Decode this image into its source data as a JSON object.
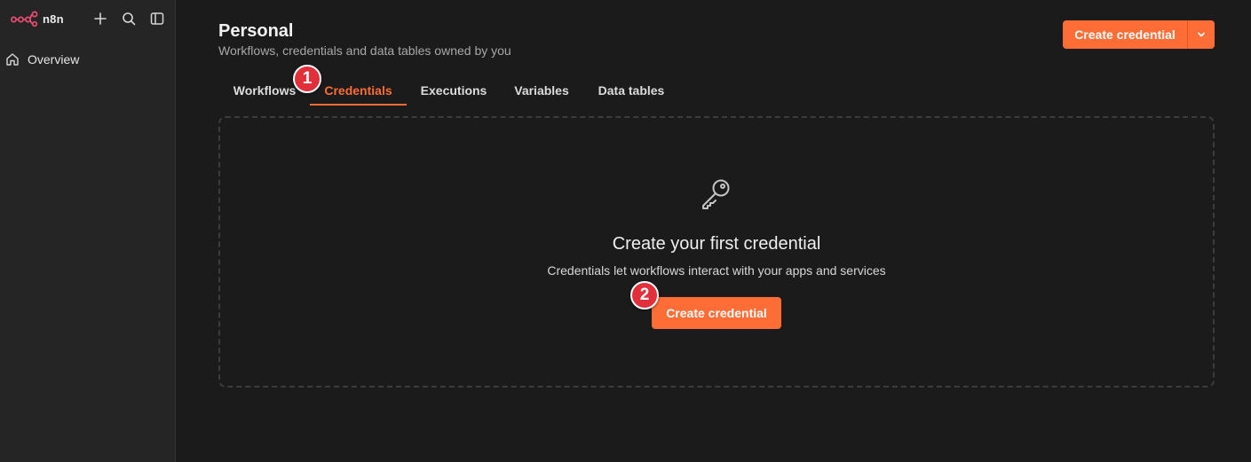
{
  "app": {
    "brand": "n8n",
    "accent_color": "#ff6d36"
  },
  "sidebar": {
    "icons": [
      "add-icon",
      "search-icon",
      "toggle-sidebar-icon"
    ],
    "items": [
      {
        "label": "Overview",
        "icon": "home-icon"
      }
    ]
  },
  "header": {
    "title": "Personal",
    "subtitle": "Workflows, credentials and data tables owned by you",
    "create_button": "Create credential",
    "dropdown_icon": "chevron-down-icon"
  },
  "tabs": [
    {
      "label": "Workflows",
      "active": false
    },
    {
      "label": "Credentials",
      "active": true
    },
    {
      "label": "Executions",
      "active": false
    },
    {
      "label": "Variables",
      "active": false
    },
    {
      "label": "Data tables",
      "active": false
    }
  ],
  "empty_state": {
    "icon": "key-icon",
    "title": "Create your first credential",
    "description": "Credentials let workflows interact with your apps and services",
    "button": "Create credential"
  },
  "annotations": [
    {
      "label": "1"
    },
    {
      "label": "2"
    }
  ]
}
